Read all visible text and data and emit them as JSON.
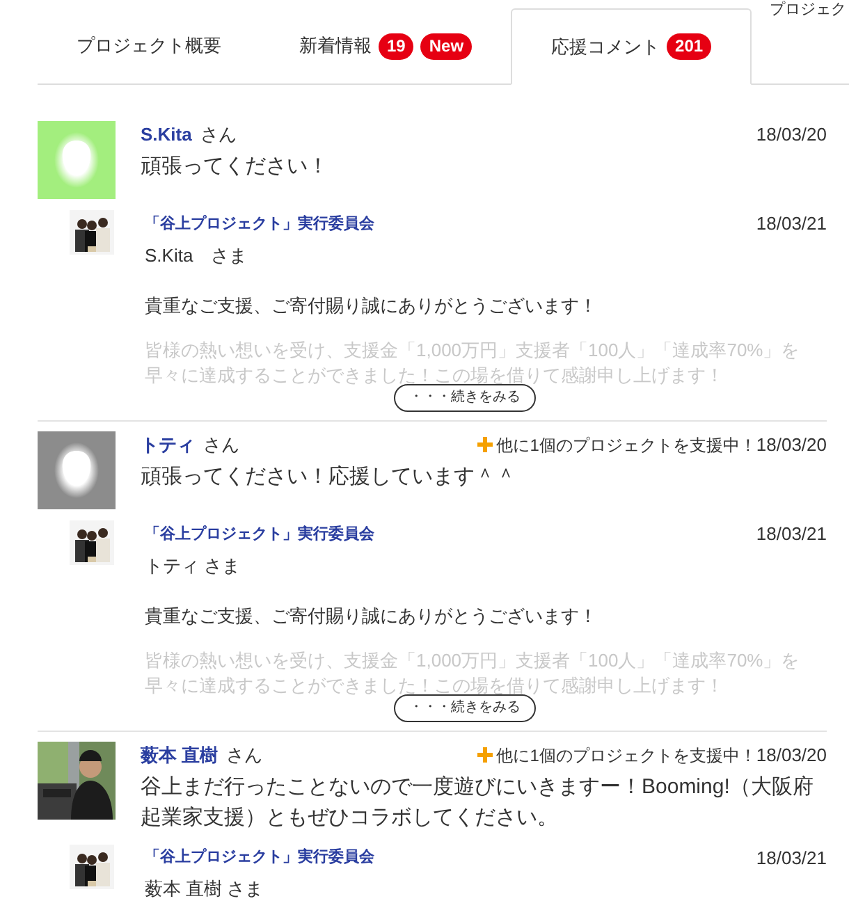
{
  "header_fragment": "プロジェク",
  "tabs": [
    {
      "label": "プロジェクト概要",
      "selected": false
    },
    {
      "label": "新着情報",
      "selected": false,
      "badges": [
        "19",
        "New"
      ]
    },
    {
      "label": "応援コメント",
      "selected": true,
      "badges": [
        "201"
      ]
    }
  ],
  "comments": [
    {
      "avatar": {
        "kind": "placeholder",
        "color": "#a3ee7e"
      },
      "name": "S.Kita",
      "honorific": "さん",
      "date": "18/03/20",
      "body": "頑張ってください！",
      "reply": {
        "author": "「谷上プロジェクト」実行委員会",
        "date": "18/03/21",
        "greeting": "S.Kita　さま",
        "paragraphs": [
          "貴重なご支援、ご寄付賜り誠にありがとうございます！",
          "皆様の熱い想いを受け、支援金「1,000万円」支援者「100人」「達成率70%」を早々に達成することができました！この場を借りて感謝申し上げます！"
        ],
        "more": "・・・続きをみる"
      }
    },
    {
      "avatar": {
        "kind": "placeholder",
        "color": "#8c8c8c"
      },
      "name": "トティ",
      "honorific": "さん",
      "support_note": "他に1個のプロジェクトを支援中！",
      "date": "18/03/20",
      "body": "頑張ってください！応援しています＾＾",
      "reply": {
        "author": "「谷上プロジェクト」実行委員会",
        "date": "18/03/21",
        "greeting": "トティ さま",
        "paragraphs": [
          "貴重なご支援、ご寄付賜り誠にありがとうございます！",
          "皆様の熱い想いを受け、支援金「1,000万円」支援者「100人」「達成率70%」を早々に達成することができました！この場を借りて感謝申し上げます！"
        ],
        "more": "・・・続きをみる"
      }
    },
    {
      "name": "薮本 直樹",
      "honorific": "さん",
      "support_note": "他に1個のプロジェクトを支援中！",
      "date": "18/03/20",
      "body": "谷上まだ行ったことないので一度遊びにいきますー！Booming!（大阪府起業家支援）ともぜひコラボしてください。",
      "reply": {
        "author": "「谷上プロジェクト」実行委員会",
        "date": "18/03/21",
        "greeting": "薮本 直樹 さま"
      }
    }
  ]
}
